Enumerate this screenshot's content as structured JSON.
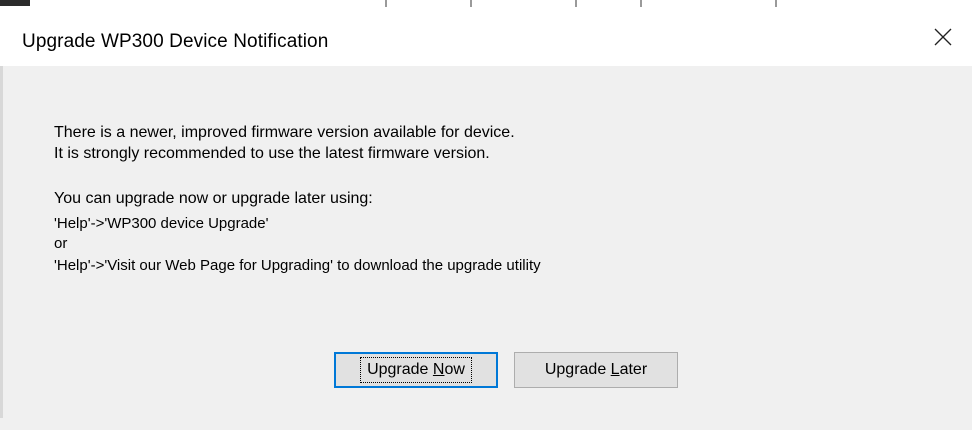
{
  "dialog": {
    "title": "Upgrade WP300 Device Notification",
    "close_icon": "close-icon"
  },
  "message": {
    "line1": "There is a newer, improved firmware version available for device.",
    "line2": "It is strongly recommended to use the latest firmware version.",
    "line3": "You can upgrade now or upgrade later using:",
    "line4": "'Help'->'WP300 device Upgrade'",
    "line5": "or",
    "line6": "'Help'->'Visit our Web Page for Upgrading' to download the upgrade utility"
  },
  "buttons": {
    "upgrade_now_pre": "Upgrade ",
    "upgrade_now_accel": "N",
    "upgrade_now_post": "ow",
    "upgrade_later_pre": "Upgrade ",
    "upgrade_later_accel": "L",
    "upgrade_later_post": "ater"
  },
  "colors": {
    "dialog_bg": "#f0f0f0",
    "titlebar_bg": "#ffffff",
    "button_bg": "#e1e1e1",
    "focus_border": "#0078d7"
  }
}
